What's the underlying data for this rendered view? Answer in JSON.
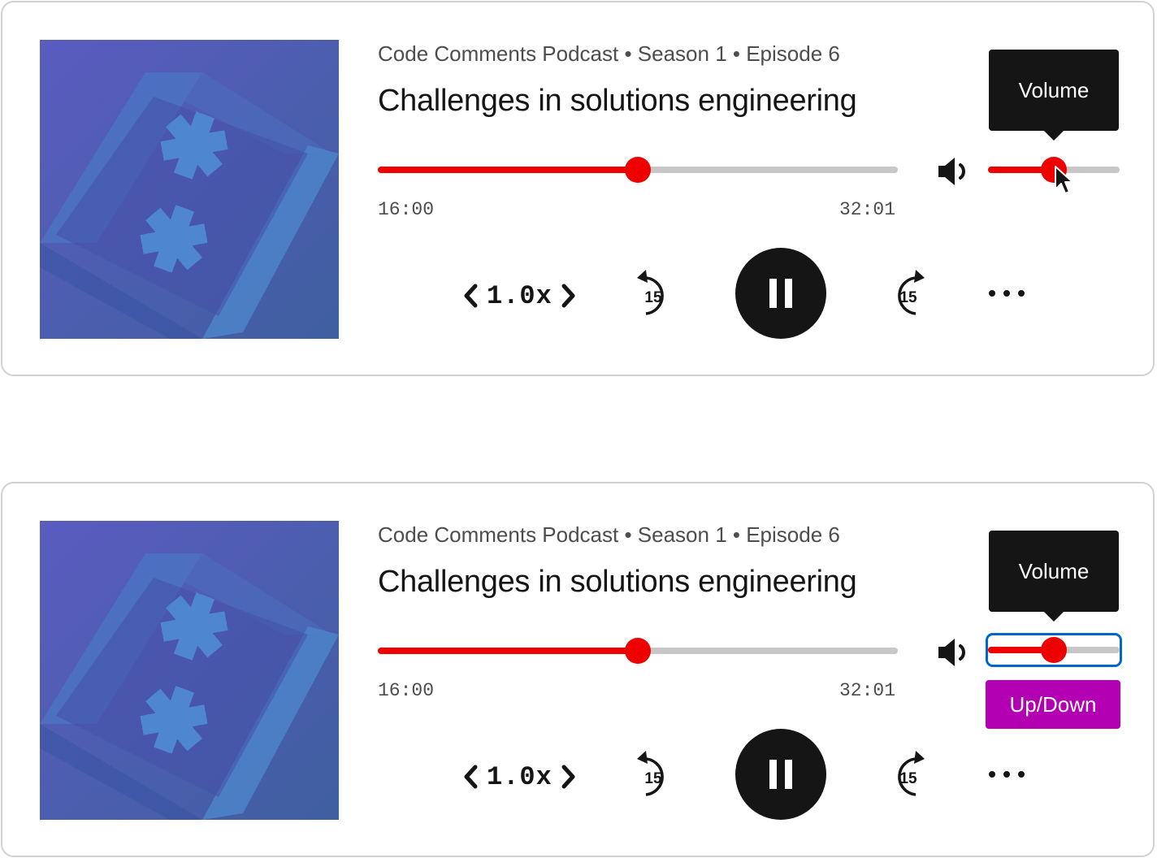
{
  "players": [
    {
      "meta": "Code Comments Podcast • Season 1 • Episode 6",
      "title": "Challenges in solutions engineering",
      "current_time": "16:00",
      "duration": "32:01",
      "progress_fraction": 0.5,
      "volume_fraction": 0.5,
      "volume_focused": false,
      "tooltip": "Volume",
      "playback_rate": "1.0x",
      "skip_back_seconds": "15",
      "skip_forward_seconds": "15"
    },
    {
      "meta": "Code Comments Podcast • Season 1 • Episode 6",
      "title": "Challenges in solutions engineering",
      "current_time": "16:00",
      "duration": "32:01",
      "progress_fraction": 0.5,
      "volume_fraction": 0.5,
      "volume_focused": true,
      "tooltip": "Volume",
      "keyboard_hint": "Up/Down",
      "playback_rate": "1.0x",
      "skip_back_seconds": "15",
      "skip_forward_seconds": "15"
    }
  ],
  "colors": {
    "accent": "#ee0000",
    "track": "#c7c7c7",
    "focus": "#0066cc",
    "hint": "#b300b3",
    "dark": "#151515"
  },
  "icons": {
    "volume": "speaker-icon",
    "back": "rewind-15-icon",
    "forward": "forward-15-icon",
    "play_state": "pause-icon",
    "more": "ellipsis-icon"
  }
}
